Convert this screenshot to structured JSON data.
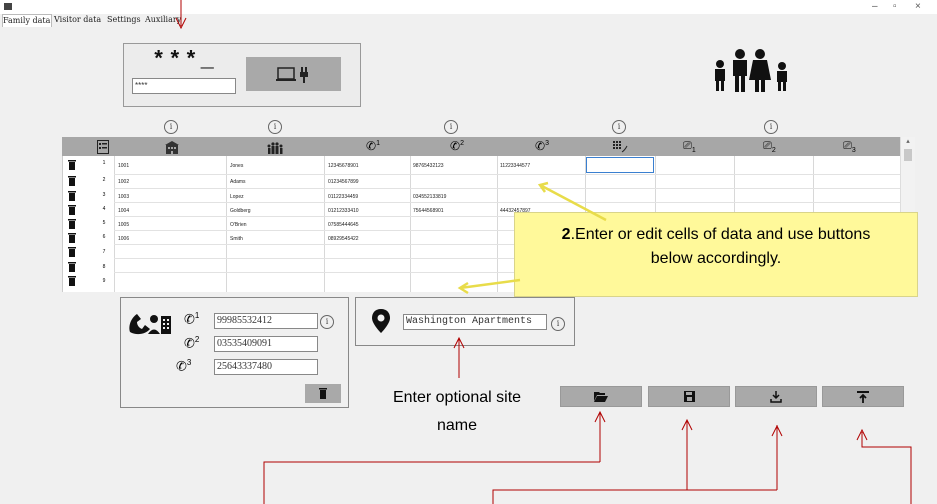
{
  "window": {
    "minimize": "–",
    "restore": "▫",
    "close": "×"
  },
  "tabs": [
    "Family data",
    "Visitor data",
    "Settings",
    "Auxiliary"
  ],
  "pin": {
    "display": "***_",
    "input_value": "****"
  },
  "grid": {
    "rows": [
      {
        "n": "1",
        "unit": "1001",
        "name": "Jones",
        "p1": "12345678901",
        "p2": "98765432123",
        "p3": "11223344577"
      },
      {
        "n": "2",
        "unit": "1002",
        "name": "Adams",
        "p1": "01234567899",
        "p2": "",
        "p3": ""
      },
      {
        "n": "3",
        "unit": "1003",
        "name": "Lopez",
        "p1": "01122334459",
        "p2": "034552133819",
        "p3": ""
      },
      {
        "n": "4",
        "unit": "1004",
        "name": "Goldberg",
        "p1": "01212333410",
        "p2": "75644568901",
        "p3": "44432457897"
      },
      {
        "n": "5",
        "unit": "1005",
        "name": "O'Brien",
        "p1": "07585444645",
        "p2": "",
        "p3": ""
      },
      {
        "n": "6",
        "unit": "1006",
        "name": "Smith",
        "p1": "08929545422",
        "p2": "",
        "p3": ""
      },
      {
        "n": "7",
        "unit": "",
        "name": "",
        "p1": "",
        "p2": "",
        "p3": ""
      },
      {
        "n": "8",
        "unit": "",
        "name": "",
        "p1": "",
        "p2": "",
        "p3": ""
      },
      {
        "n": "9",
        "unit": "",
        "name": "",
        "p1": "",
        "p2": "",
        "p3": ""
      }
    ],
    "header_subscripts": {
      "p1": "1",
      "p2": "2",
      "p3": "3",
      "r1": "1",
      "r2": "2",
      "r3": "3"
    }
  },
  "site_phones": {
    "phone1": "99985532412",
    "phone2": "03535409091",
    "phone3": "25643337480",
    "labels": [
      "1",
      "2",
      "3"
    ]
  },
  "site": {
    "name": "Washington Apartments"
  },
  "info_symbol": "i",
  "callouts": {
    "step2_bold": "2",
    "step2_text": ".Enter or edit cells of data and use buttons below accordingly.",
    "site_name_note": "Enter optional site name"
  },
  "colors": {
    "callout_bg": "#fff99a",
    "header_bg": "#a7a7a7",
    "arrow": "#b00000"
  }
}
